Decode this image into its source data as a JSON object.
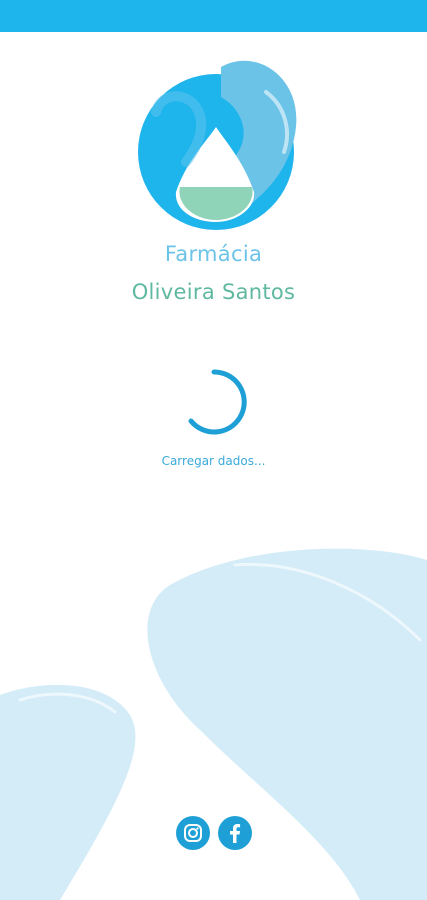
{
  "colors": {
    "status_bar": "#1eb4ec",
    "brand_primary": "#6cc3e8",
    "brand_secondary": "#5fb8a0",
    "accent": "#1ea0d6",
    "background_shape": "#d3ecf8"
  },
  "brand": {
    "line1": "Farmácia",
    "line2": "Oliveira Santos",
    "logo_icon": "water-drop-logo-icon"
  },
  "loading": {
    "text": "Carregar dados..."
  },
  "social": {
    "instagram_icon": "instagram-icon",
    "facebook_icon": "facebook-icon"
  }
}
